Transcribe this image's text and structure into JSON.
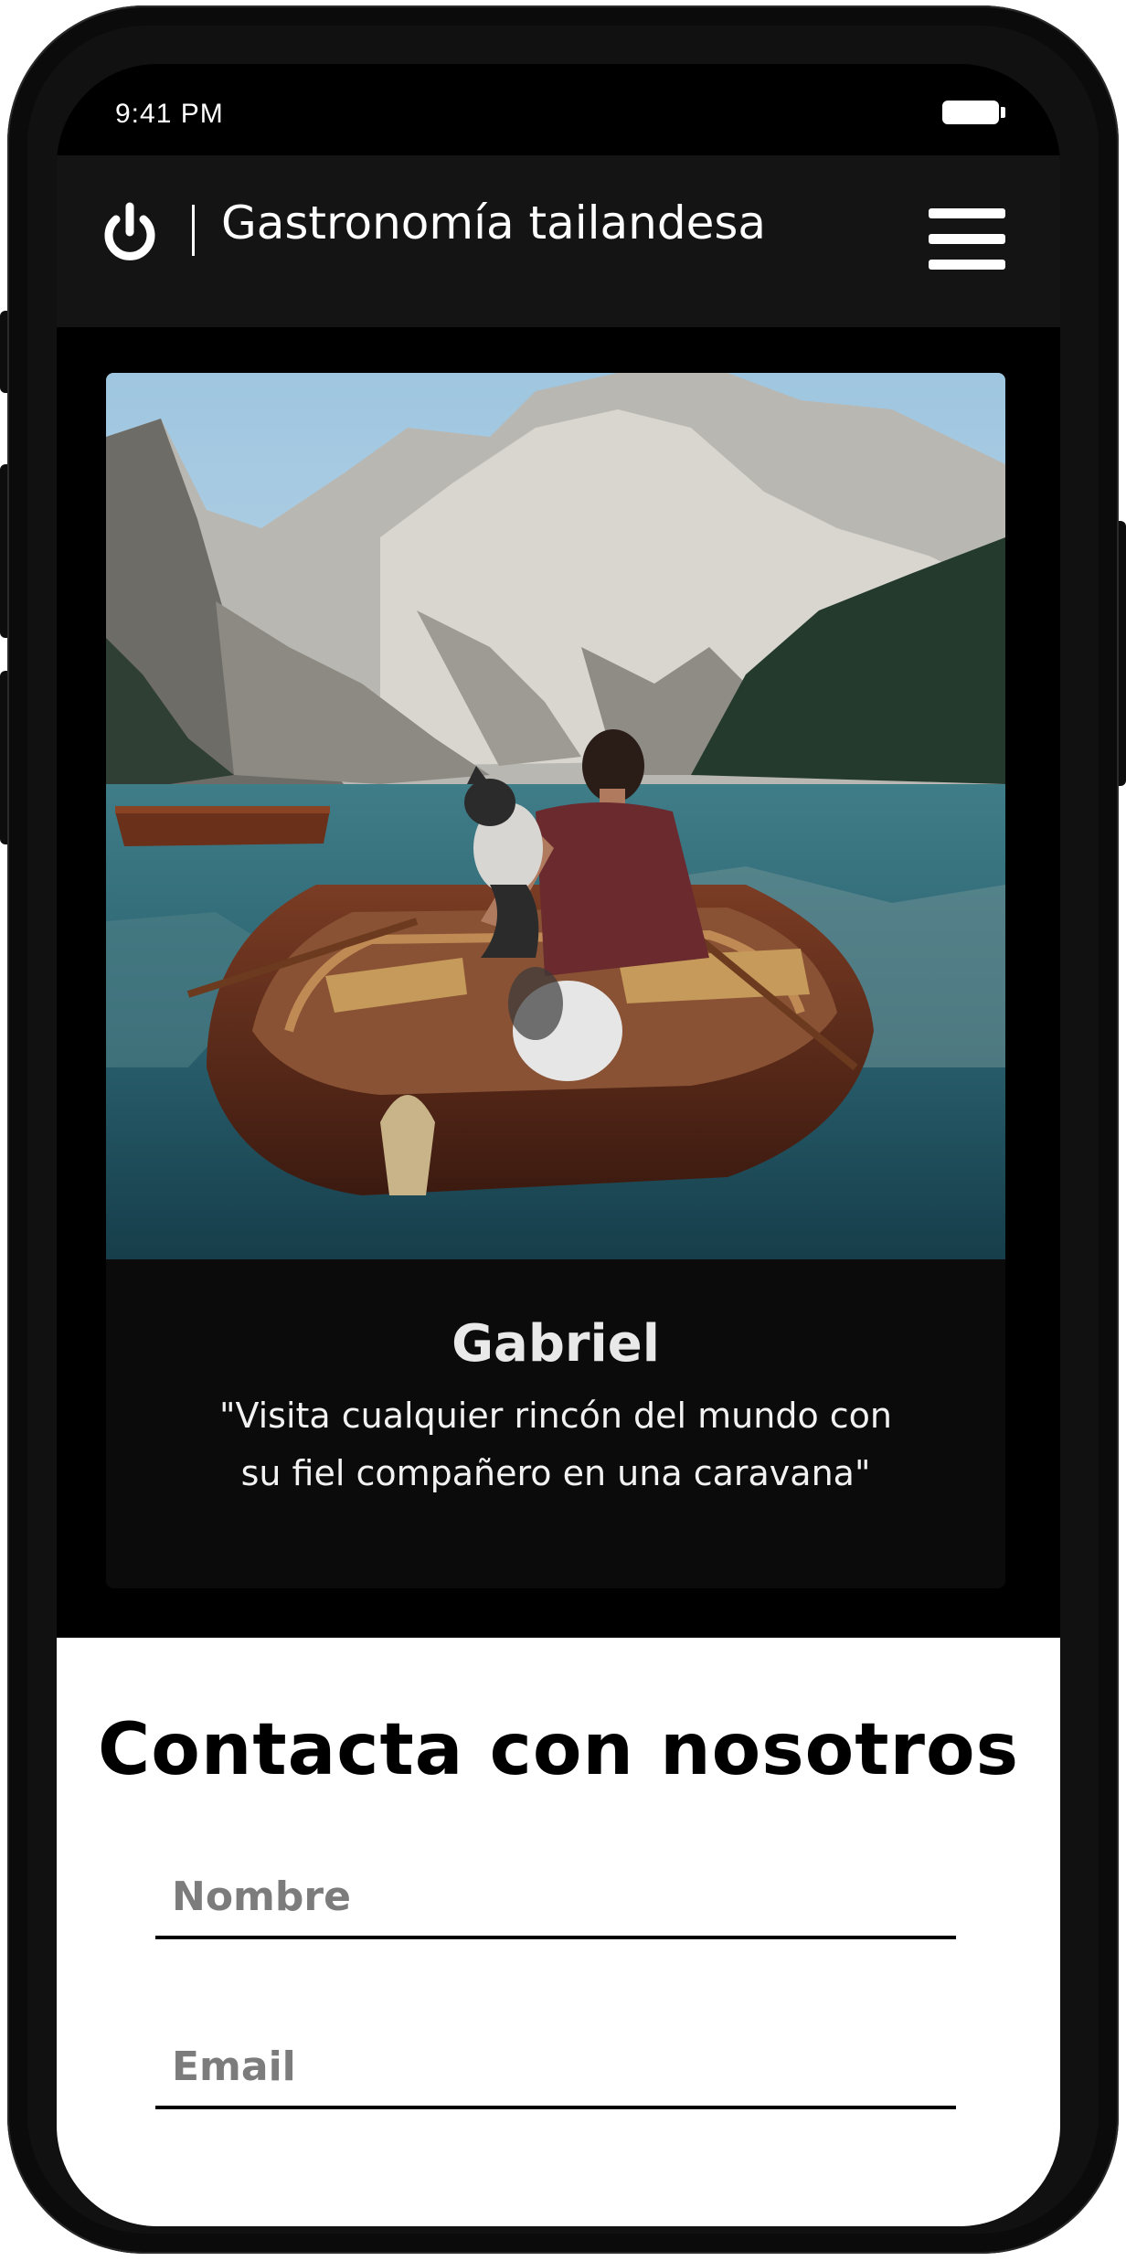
{
  "status_bar": {
    "time": "9:41 PM"
  },
  "header": {
    "title": "Gastronomía tailandesa"
  },
  "testimonial": {
    "name": "Gabriel",
    "quote": "\"Visita cualquier rincón del mundo con su fiel compañero en una caravana\""
  },
  "contact": {
    "title": "Contacta con nosotros",
    "name_placeholder": "Nombre",
    "email_placeholder": "Email"
  },
  "icons": {
    "logo": "power-icon",
    "menu": "hamburger-menu-icon",
    "battery": "battery-icon"
  },
  "colors": {
    "header_bg": "#141414",
    "card_bg": "#0b0b0b",
    "page_bg": "#000000",
    "contact_bg": "#ffffff"
  }
}
